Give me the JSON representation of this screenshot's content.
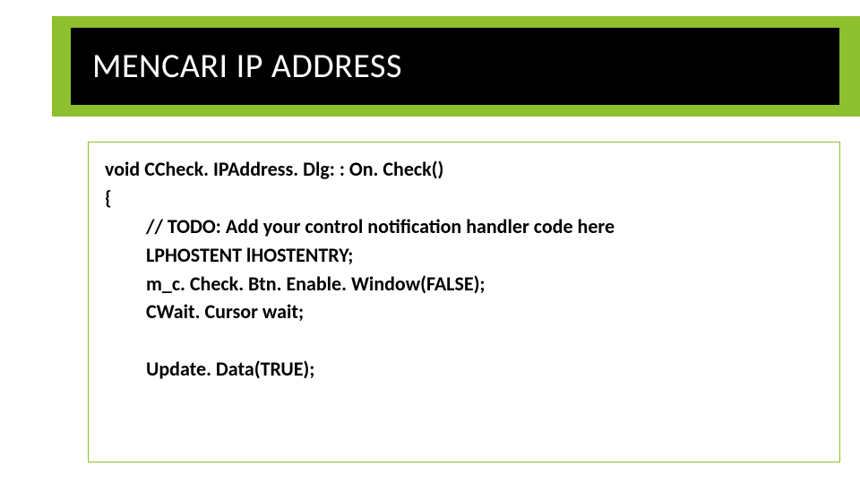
{
  "slide": {
    "title": "MENCARI IP ADDRESS",
    "code": {
      "line1": "void CCheck. IPAddress. Dlg: : On. Check()",
      "line2": "{",
      "line3": "// TODO: Add your control notification handler code here",
      "line4": "LPHOSTENT lHOSTENTRY;",
      "line5": "m_c. Check. Btn. Enable. Window(FALSE);",
      "line6": "CWait. Cursor wait;",
      "line7": "Update. Data(TRUE);"
    }
  }
}
